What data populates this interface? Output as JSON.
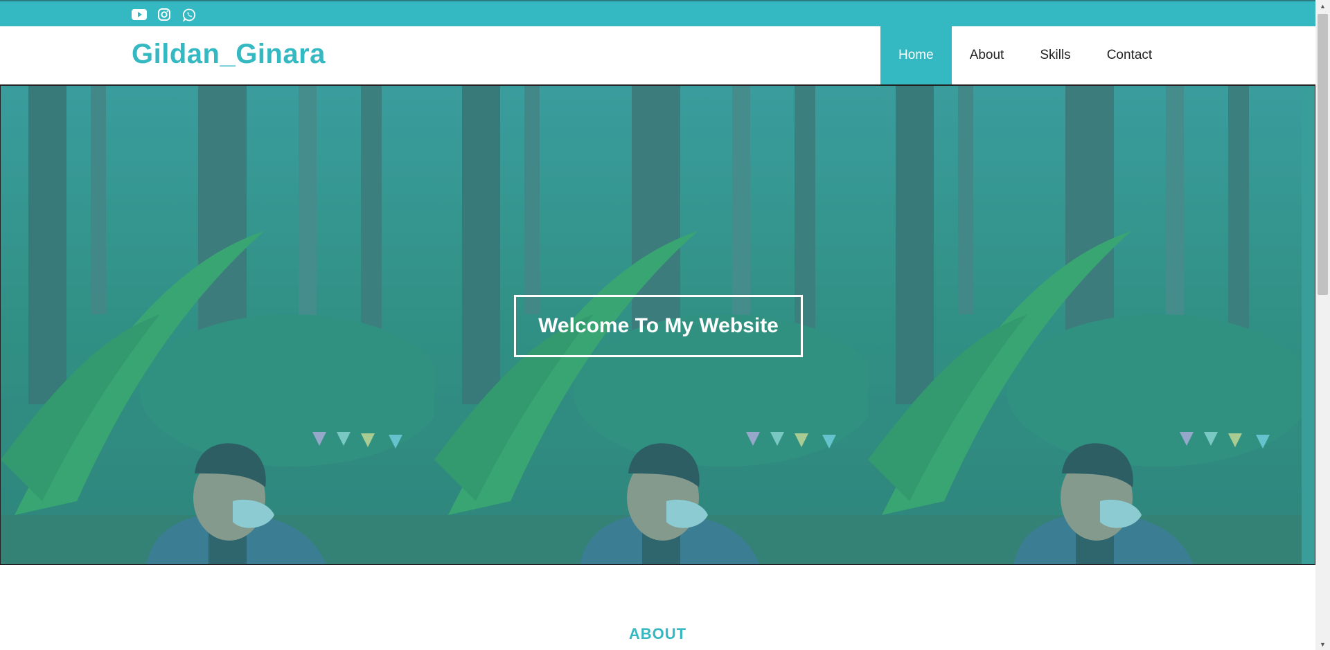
{
  "topbar": {
    "social_icons": [
      "youtube-icon",
      "instagram-icon",
      "whatsapp-icon"
    ]
  },
  "navbar": {
    "brand": "Gildan_Ginara",
    "menu": [
      {
        "label": "Home",
        "active": true
      },
      {
        "label": "About",
        "active": false
      },
      {
        "label": "Skills",
        "active": false
      },
      {
        "label": "Contact",
        "active": false
      }
    ]
  },
  "hero": {
    "welcome_text": "Welcome To My Website"
  },
  "about": {
    "title": "ABOUT"
  },
  "colors": {
    "accent": "#34b8c1",
    "text": "#222222",
    "white": "#ffffff"
  }
}
